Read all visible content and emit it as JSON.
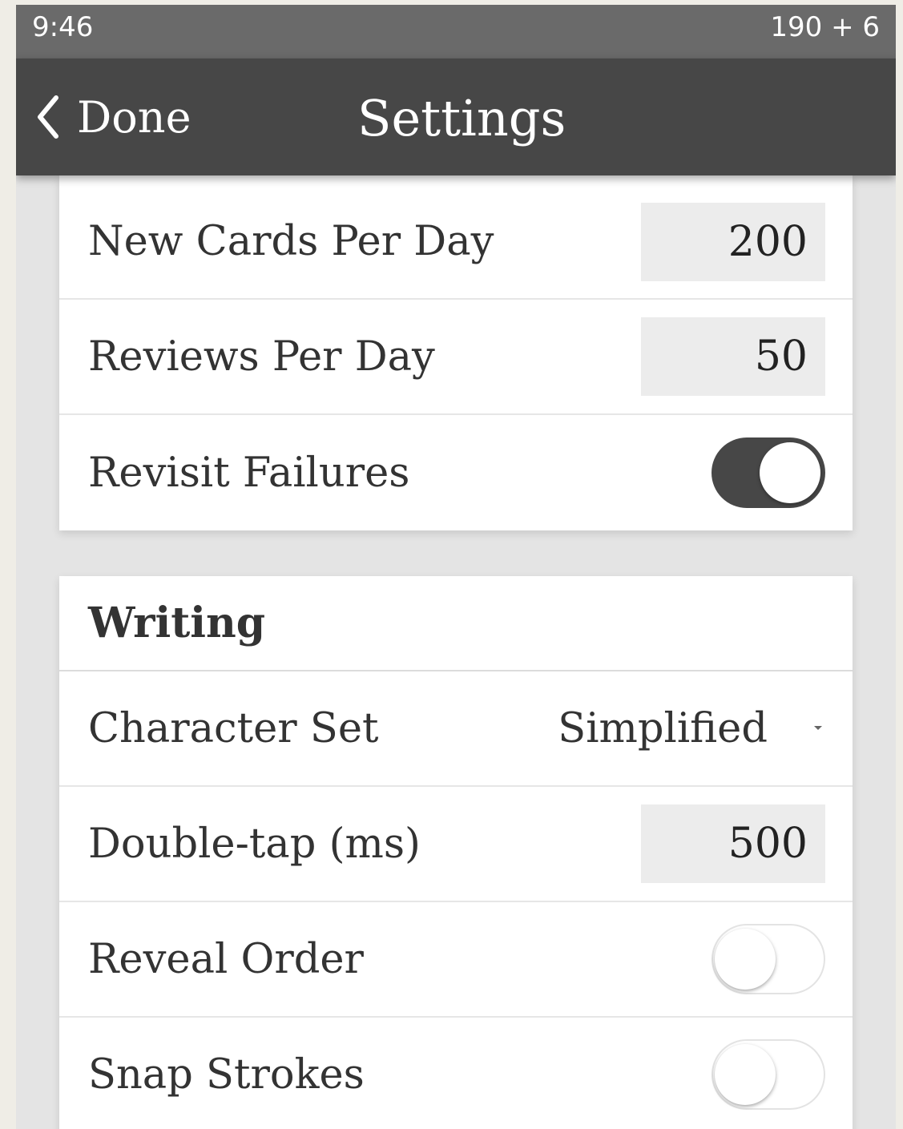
{
  "status_bar": {
    "time": "9:46",
    "count": "190 + 6"
  },
  "nav": {
    "back_label": "Done",
    "back_icon": "chevron-left-icon",
    "title": "Settings"
  },
  "study": {
    "new_cards_per_day": {
      "label": "New Cards Per Day",
      "value": "200"
    },
    "reviews_per_day": {
      "label": "Reviews Per Day",
      "value": "50"
    },
    "revisit_failures": {
      "label": "Revisit Failures",
      "enabled": true
    }
  },
  "writing": {
    "heading": "Writing",
    "character_set": {
      "label": "Character Set",
      "value": "Simplified"
    },
    "double_tap": {
      "label": "Double-tap (ms)",
      "value": "500"
    },
    "reveal_order": {
      "label": "Reveal Order",
      "enabled": false
    },
    "snap_strokes": {
      "label": "Snap Strokes",
      "enabled": false
    }
  },
  "colors": {
    "status_bar": "#6a6a6a",
    "nav_bar": "#474747",
    "toggle_on": "#474747",
    "page_background": "#e4e4e4",
    "input_background": "#ececec"
  }
}
